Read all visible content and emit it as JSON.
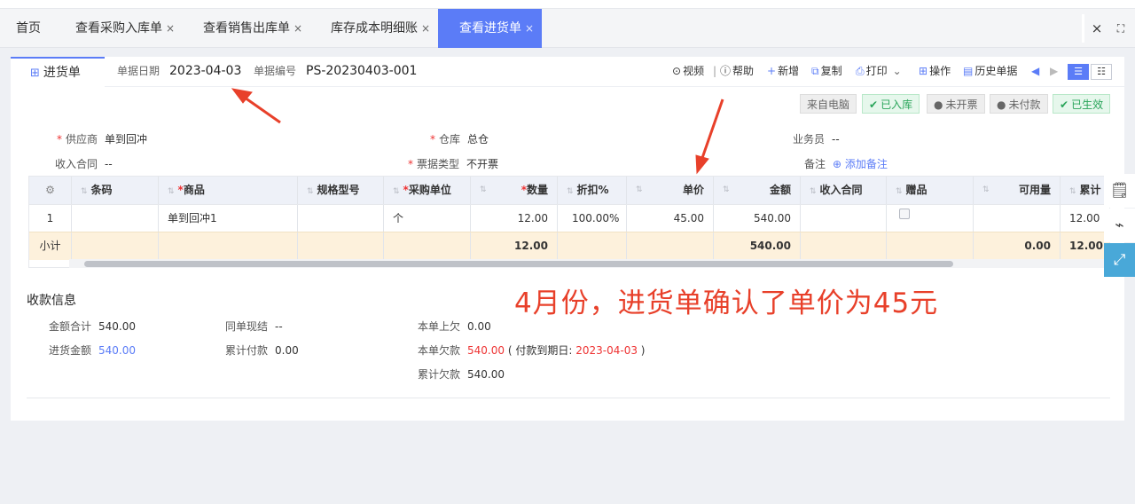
{
  "tabs": [
    {
      "label": "首页",
      "closable": false
    },
    {
      "label": "查看采购入库单",
      "closable": true
    },
    {
      "label": "查看销售出库单",
      "closable": true
    },
    {
      "label": "库存成本明细账",
      "closable": true
    },
    {
      "label": "查看进货单",
      "closable": true,
      "active": true
    }
  ],
  "window_controls": {
    "close": "×",
    "fullscreen": "⛶"
  },
  "header": {
    "doc_title": "进货单",
    "date_label": "单据日期",
    "date_value": "2023-04-03",
    "no_label": "单据编号",
    "no_value": "PS-20230403-001",
    "actions": {
      "video": "视频",
      "help": "帮助",
      "add": "新增",
      "copy": "复制",
      "print": "打印",
      "operate": "操作",
      "history": "历史单据"
    }
  },
  "badges": [
    {
      "label": "来自电脑",
      "style": "gray"
    },
    {
      "label": "已入库",
      "style": "green"
    },
    {
      "label": "未开票",
      "style": "gray"
    },
    {
      "label": "未付款",
      "style": "gray"
    },
    {
      "label": "已生效",
      "style": "green"
    }
  ],
  "form": {
    "supplier_label": "供应商",
    "supplier_value": "单到回冲",
    "warehouse_label": "仓库",
    "warehouse_value": "总仓",
    "salesman_label": "业务员",
    "salesman_value": "--",
    "contract_label": "收入合同",
    "contract_value": "--",
    "invoice_label": "票据类型",
    "invoice_value": "不开票",
    "remark_label": "备注",
    "remark_link": "添加备注"
  },
  "table": {
    "columns": [
      "条码",
      "商品",
      "规格型号",
      "采购单位",
      "数量",
      "折扣%",
      "单价",
      "金额",
      "收入合同",
      "赠品",
      "可用量",
      "累计"
    ],
    "rows": [
      {
        "idx": "1",
        "barcode": "",
        "product": "单到回冲1",
        "spec": "",
        "unit": "个",
        "qty": "12.00",
        "discount": "100.00%",
        "price": "45.00",
        "amount": "540.00",
        "contract": "",
        "available": "",
        "cumulative": "12.00"
      }
    ],
    "subtotal": {
      "label": "小计",
      "qty": "12.00",
      "amount": "540.00",
      "available": "0.00",
      "cumulative": "12.00"
    }
  },
  "payment": {
    "title": "收款信息",
    "total_label": "金额合计",
    "total_value": "540.00",
    "purchase_label": "进货金额",
    "purchase_value": "540.00",
    "cash_label": "同单现结",
    "cash_value": "--",
    "paid_label": "累计付款",
    "paid_value": "0.00",
    "prev_owed_label": "本单上欠",
    "prev_owed_value": "0.00",
    "owed_label": "本单欠款",
    "owed_value": "540.00",
    "due_prefix": "( 付款到期日:",
    "due_date": "2023-04-03",
    "due_suffix": ")",
    "total_owed_label": "累计欠款",
    "total_owed_value": "540.00"
  },
  "annotation": {
    "text": "4月份，进货单确认了单价为45元",
    "color": "#e8402a"
  },
  "colors": {
    "accent": "#5b7cf7",
    "required": "#e33333",
    "subtotal_bg": "#fdf1dc",
    "header_bg": "#eef1f8"
  }
}
